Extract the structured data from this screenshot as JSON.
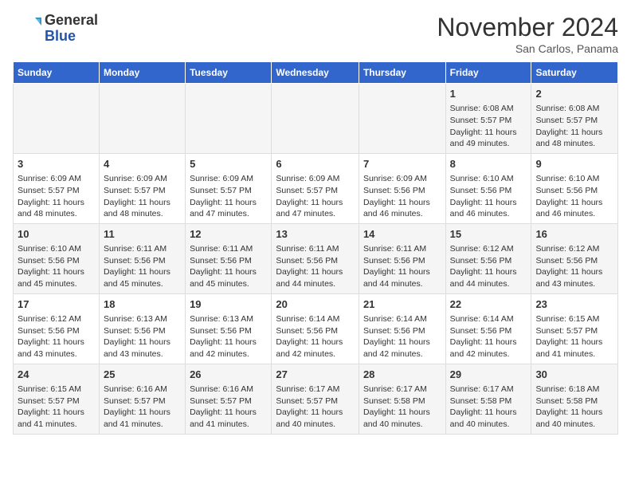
{
  "logo": {
    "general": "General",
    "blue": "Blue"
  },
  "title": "November 2024",
  "subtitle": "San Carlos, Panama",
  "days_header": [
    "Sunday",
    "Monday",
    "Tuesday",
    "Wednesday",
    "Thursday",
    "Friday",
    "Saturday"
  ],
  "weeks": [
    [
      {
        "day": "",
        "info": ""
      },
      {
        "day": "",
        "info": ""
      },
      {
        "day": "",
        "info": ""
      },
      {
        "day": "",
        "info": ""
      },
      {
        "day": "",
        "info": ""
      },
      {
        "day": "1",
        "info": "Sunrise: 6:08 AM\nSunset: 5:57 PM\nDaylight: 11 hours and 49 minutes."
      },
      {
        "day": "2",
        "info": "Sunrise: 6:08 AM\nSunset: 5:57 PM\nDaylight: 11 hours and 48 minutes."
      }
    ],
    [
      {
        "day": "3",
        "info": "Sunrise: 6:09 AM\nSunset: 5:57 PM\nDaylight: 11 hours and 48 minutes."
      },
      {
        "day": "4",
        "info": "Sunrise: 6:09 AM\nSunset: 5:57 PM\nDaylight: 11 hours and 48 minutes."
      },
      {
        "day": "5",
        "info": "Sunrise: 6:09 AM\nSunset: 5:57 PM\nDaylight: 11 hours and 47 minutes."
      },
      {
        "day": "6",
        "info": "Sunrise: 6:09 AM\nSunset: 5:57 PM\nDaylight: 11 hours and 47 minutes."
      },
      {
        "day": "7",
        "info": "Sunrise: 6:09 AM\nSunset: 5:56 PM\nDaylight: 11 hours and 46 minutes."
      },
      {
        "day": "8",
        "info": "Sunrise: 6:10 AM\nSunset: 5:56 PM\nDaylight: 11 hours and 46 minutes."
      },
      {
        "day": "9",
        "info": "Sunrise: 6:10 AM\nSunset: 5:56 PM\nDaylight: 11 hours and 46 minutes."
      }
    ],
    [
      {
        "day": "10",
        "info": "Sunrise: 6:10 AM\nSunset: 5:56 PM\nDaylight: 11 hours and 45 minutes."
      },
      {
        "day": "11",
        "info": "Sunrise: 6:11 AM\nSunset: 5:56 PM\nDaylight: 11 hours and 45 minutes."
      },
      {
        "day": "12",
        "info": "Sunrise: 6:11 AM\nSunset: 5:56 PM\nDaylight: 11 hours and 45 minutes."
      },
      {
        "day": "13",
        "info": "Sunrise: 6:11 AM\nSunset: 5:56 PM\nDaylight: 11 hours and 44 minutes."
      },
      {
        "day": "14",
        "info": "Sunrise: 6:11 AM\nSunset: 5:56 PM\nDaylight: 11 hours and 44 minutes."
      },
      {
        "day": "15",
        "info": "Sunrise: 6:12 AM\nSunset: 5:56 PM\nDaylight: 11 hours and 44 minutes."
      },
      {
        "day": "16",
        "info": "Sunrise: 6:12 AM\nSunset: 5:56 PM\nDaylight: 11 hours and 43 minutes."
      }
    ],
    [
      {
        "day": "17",
        "info": "Sunrise: 6:12 AM\nSunset: 5:56 PM\nDaylight: 11 hours and 43 minutes."
      },
      {
        "day": "18",
        "info": "Sunrise: 6:13 AM\nSunset: 5:56 PM\nDaylight: 11 hours and 43 minutes."
      },
      {
        "day": "19",
        "info": "Sunrise: 6:13 AM\nSunset: 5:56 PM\nDaylight: 11 hours and 42 minutes."
      },
      {
        "day": "20",
        "info": "Sunrise: 6:14 AM\nSunset: 5:56 PM\nDaylight: 11 hours and 42 minutes."
      },
      {
        "day": "21",
        "info": "Sunrise: 6:14 AM\nSunset: 5:56 PM\nDaylight: 11 hours and 42 minutes."
      },
      {
        "day": "22",
        "info": "Sunrise: 6:14 AM\nSunset: 5:56 PM\nDaylight: 11 hours and 42 minutes."
      },
      {
        "day": "23",
        "info": "Sunrise: 6:15 AM\nSunset: 5:57 PM\nDaylight: 11 hours and 41 minutes."
      }
    ],
    [
      {
        "day": "24",
        "info": "Sunrise: 6:15 AM\nSunset: 5:57 PM\nDaylight: 11 hours and 41 minutes."
      },
      {
        "day": "25",
        "info": "Sunrise: 6:16 AM\nSunset: 5:57 PM\nDaylight: 11 hours and 41 minutes."
      },
      {
        "day": "26",
        "info": "Sunrise: 6:16 AM\nSunset: 5:57 PM\nDaylight: 11 hours and 41 minutes."
      },
      {
        "day": "27",
        "info": "Sunrise: 6:17 AM\nSunset: 5:57 PM\nDaylight: 11 hours and 40 minutes."
      },
      {
        "day": "28",
        "info": "Sunrise: 6:17 AM\nSunset: 5:58 PM\nDaylight: 11 hours and 40 minutes."
      },
      {
        "day": "29",
        "info": "Sunrise: 6:17 AM\nSunset: 5:58 PM\nDaylight: 11 hours and 40 minutes."
      },
      {
        "day": "30",
        "info": "Sunrise: 6:18 AM\nSunset: 5:58 PM\nDaylight: 11 hours and 40 minutes."
      }
    ]
  ]
}
